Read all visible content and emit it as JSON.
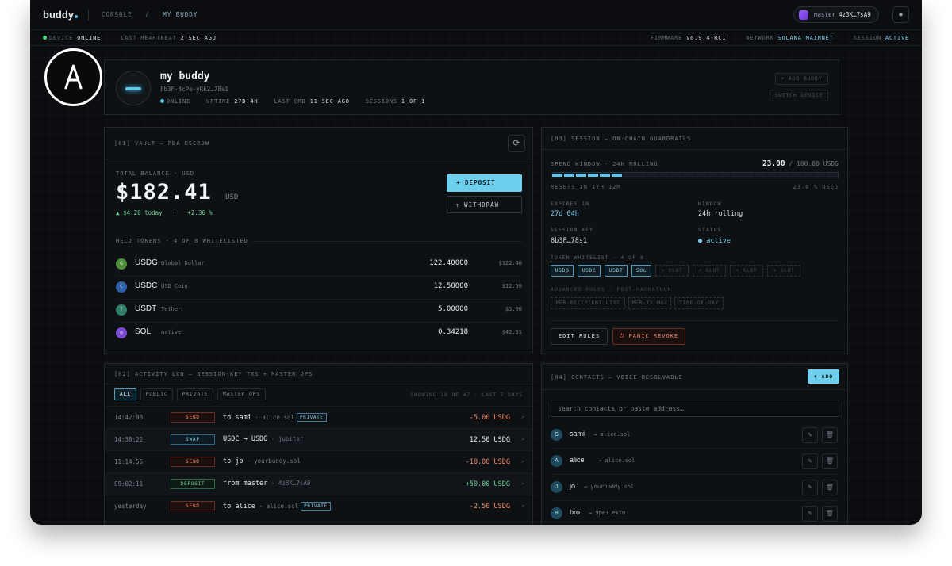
{
  "topbar": {
    "brand": "buddy",
    "crumb_console": "CONSOLE",
    "crumb_sep": "/",
    "crumb_current": "MY BUDDY",
    "master_label": "master",
    "master_addr": "4z3K…7sA9"
  },
  "status": {
    "device_label": "DEVICE",
    "device_value": "ONLINE",
    "heartbeat_label": "LAST HEARTBEAT",
    "heartbeat_value": "2 SEC AGO",
    "firmware_label": "FIRMWARE",
    "firmware_value": "V0.9.4-RC1",
    "network_label": "NETWORK",
    "network_value": "SOLANA MAINNET",
    "session_label": "SESSION",
    "session_value": "ACTIVE"
  },
  "buddy": {
    "name": "my buddy",
    "id": "8b3F·4cPe·yRk2…78s1",
    "online": "ONLINE",
    "uptime_label": "UPTIME",
    "uptime_value": "27D 4H",
    "lastcmd_label": "LAST CMD",
    "lastcmd_value": "11 SEC AGO",
    "sessions_label": "SESSIONS",
    "sessions_value": "1 OF 1",
    "add_label": "+ ADD BUDDY",
    "switch_label": "SWITCH DEVICE"
  },
  "vault": {
    "title": "[01] VAULT — PDA ESCROW",
    "balance_label": "TOTAL BALANCE · USD",
    "balance": "$182.41",
    "balance_unit": "USD",
    "change": "▲ $4.20 today   ·   +2.36 %",
    "deposit": "+ DEPOSIT",
    "withdraw": "↑ WITHDRAW",
    "held_label": "HELD TOKENS · 4 OF 8 WHITELISTED",
    "tokens": [
      {
        "icon": "G",
        "symbol": "USDG",
        "name": "Global Dollar",
        "amount": "122.40000",
        "usd": "$122.40",
        "color": "#4f8f3c"
      },
      {
        "icon": "C",
        "symbol": "USDC",
        "name": "USD Coin",
        "amount": "12.50000",
        "usd": "$12.50",
        "color": "#2f5fa8"
      },
      {
        "icon": "T",
        "symbol": "USDT",
        "name": "Tether",
        "amount": "5.00000",
        "usd": "$5.00",
        "color": "#2e7d68"
      },
      {
        "icon": "◎",
        "symbol": "SOL",
        "name": "native",
        "amount": "0.34218",
        "usd": "$42.51",
        "color": "#7a4bd6"
      }
    ]
  },
  "session": {
    "title": "[03] SESSION — ON-CHAIN GUARDRAILS",
    "spend_label": "SPEND WINDOW · 24H ROLLING",
    "spent": "23.00",
    "limit": "/ 100.00 USDG",
    "spent_fraction": 0.23,
    "resets": "RESETS IN 17H 12M",
    "used": "23.0 % USED",
    "expires_label": "EXPIRES IN",
    "expires_value": "27d 04h",
    "window_label": "WINDOW",
    "window_value": "24h rolling",
    "key_label": "SESSION KEY",
    "key_value": "8b3F…78s1",
    "status_label": "STATUS",
    "status_value": "● active",
    "whitelist_label": "TOKEN WHITELIST · 4 OF 8",
    "whitelist": [
      "USDG",
      "USDC",
      "USDT",
      "SOL"
    ],
    "slot_label": "+ SLOT",
    "advanced_label": "ADVANCED RULES · POST-HACKATHON",
    "advanced": [
      "PER-RECIPIENT LIST",
      "PER-TX MAX",
      "TIME-OF-DAY"
    ],
    "edit": "EDIT RULES",
    "panic": "⏻ PANIC REVOKE"
  },
  "activity": {
    "title": "[02] ACTIVITY LOG — SESSION-KEY TXS + MASTER OPS",
    "tabs": [
      "ALL",
      "PUBLIC",
      "PRIVATE",
      "MASTER OPS"
    ],
    "showing": "SHOWING 10 OF 47 · LAST 7 DAYS",
    "rows": [
      {
        "time": "14:42:08",
        "type": "SEND",
        "desc": "to sami",
        "meta": "alice.sol",
        "private": "PRIVATE",
        "amount": "-5.00 USDG"
      },
      {
        "time": "14:38:22",
        "type": "SWAP",
        "desc": "USDC → USDG",
        "meta": "jupiter",
        "private": "",
        "amount": "12.50 USDG"
      },
      {
        "time": "11:14:55",
        "type": "SEND",
        "desc": "to jo",
        "meta": "yourbuddy.sol",
        "private": "",
        "amount": "-10.00 USDG"
      },
      {
        "time": "09:02:11",
        "type": "DEPOSIT",
        "desc": "from master",
        "meta": "4z3K…7sA9",
        "private": "",
        "amount": "+50.00 USDG"
      },
      {
        "time": "yesterday",
        "type": "SEND",
        "desc": "to alice",
        "meta": "alice.sol",
        "private": "PRIVATE",
        "amount": "-2.50 USDG"
      }
    ]
  },
  "contacts": {
    "title": "[04] CONTACTS — VOICE-RESOLVABLE",
    "add": "+ ADD",
    "search_placeholder": "search contacts or paste address…",
    "items": [
      {
        "initial": "S",
        "name": "sami",
        "addr": "→ alice.sol"
      },
      {
        "initial": "A",
        "name": "alice",
        "addr": "→ alice.sol"
      },
      {
        "initial": "J",
        "name": "jo",
        "addr": "→ yourbuddy.sol"
      },
      {
        "initial": "B",
        "name": "bro",
        "addr": "→ 9pP1…ekTm"
      }
    ]
  },
  "icons": {
    "gear": "gear-icon",
    "refresh": "refresh-icon",
    "edit": "pencil-icon",
    "delete": "trash-icon",
    "external": "external-link-icon",
    "logo": "accessibility-logo-icon"
  }
}
